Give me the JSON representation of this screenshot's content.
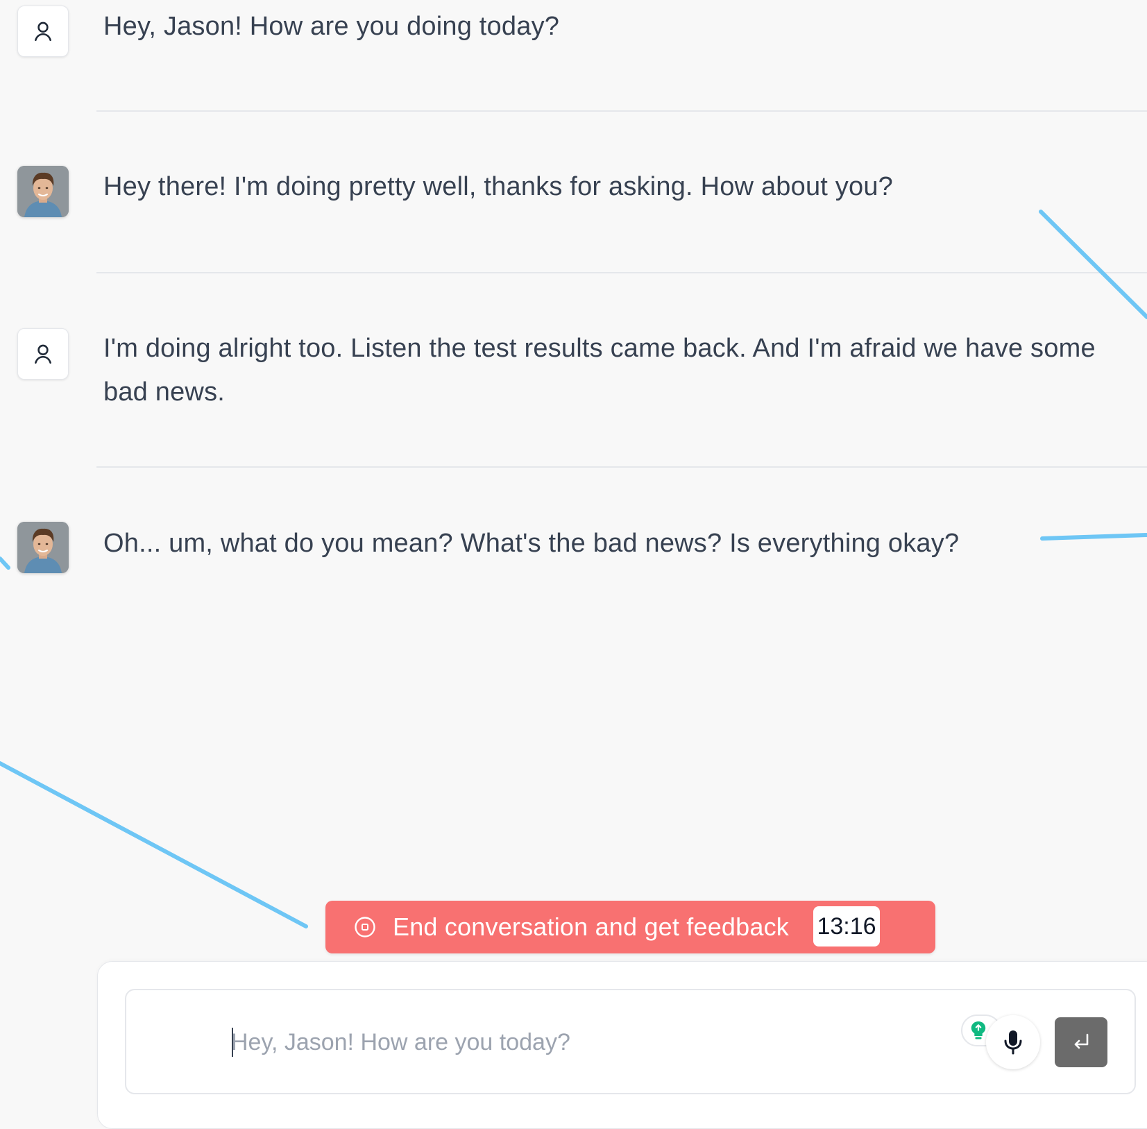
{
  "messages": [
    {
      "sender": "user",
      "avatar_icon": "user-outline-icon",
      "text": "Hey, Jason! How are you doing today?"
    },
    {
      "sender": "ai",
      "avatar_icon": "jason-avatar",
      "text": "Hey there! I'm doing pretty well, thanks for asking. How about you?"
    },
    {
      "sender": "user",
      "avatar_icon": "user-outline-icon",
      "text": "I'm doing alright too. Listen the test results came back. And I'm afraid we have some bad news."
    },
    {
      "sender": "ai",
      "avatar_icon": "jason-avatar",
      "text": "Oh... um, what do you mean? What's the bad news? Is everything okay?"
    }
  ],
  "end_conversation": {
    "label": "End conversation and get feedback",
    "timer": "13:16",
    "icon": "stop-circle-icon",
    "color": "#f87171"
  },
  "composer": {
    "value": "",
    "placeholder": "Hey, Jason! How are you today?",
    "hint_icon": "lightbulb-icon",
    "mic_icon": "microphone-icon",
    "send_icon": "enter-return-icon"
  },
  "colors": {
    "background": "#f8f8f8",
    "text": "#374151",
    "divider": "#e5e7eb",
    "annotation_line": "#6ec6f5",
    "hint_green": "#10b981",
    "send_button": "#6b6b6b"
  }
}
